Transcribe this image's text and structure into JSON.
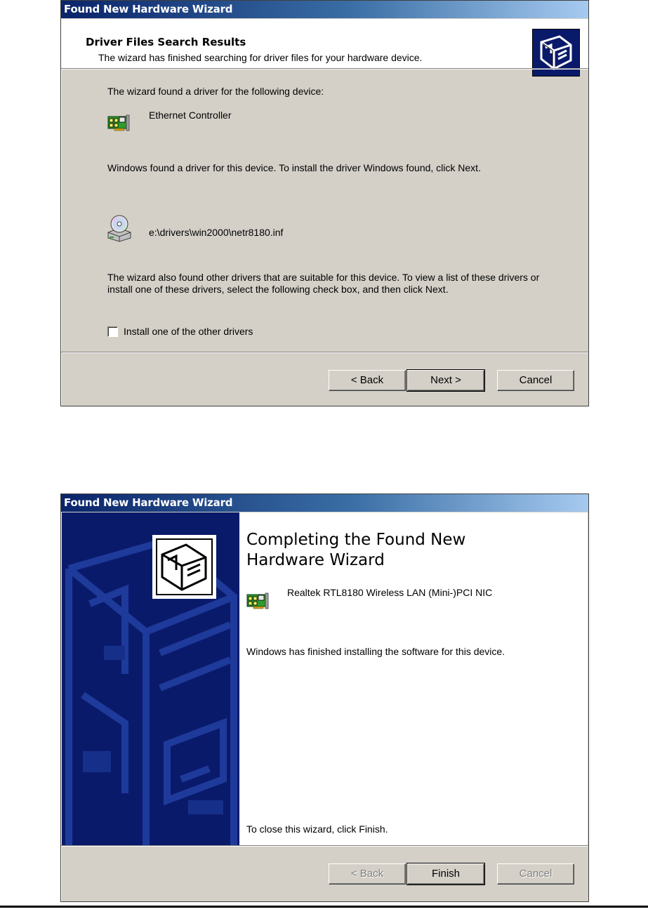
{
  "wizard1": {
    "title": "Found New Hardware Wizard",
    "header_title": "Driver Files Search Results",
    "header_subtitle": "The wizard has finished searching for driver files for your hardware device.",
    "found_text": "The wizard found a driver for the following device:",
    "device_name": "Ethernet Controller",
    "instructions": "Windows found a driver for this device. To install the driver Windows found, click Next.",
    "driver_path": "e:\\drivers\\win2000\\netr8180.inf",
    "other_drivers_text": "The wizard also found other drivers that are suitable for this device. To view a list of these drivers or install one of these drivers, select the following check box, and then click Next.",
    "checkbox_label": "Install one of the other drivers",
    "checkbox_checked": false,
    "back_label": "< Back",
    "next_label": "Next >",
    "cancel_label": "Cancel"
  },
  "wizard2": {
    "title": "Found New Hardware Wizard",
    "heading": "Completing the Found New Hardware Wizard",
    "device_name": "Realtek RTL8180 Wireless LAN (Mini-)PCI NIC",
    "finished_text": "Windows has finished installing the software for this device.",
    "close_text": "To close this wizard, click Finish.",
    "back_label": "< Back",
    "finish_label": "Finish",
    "cancel_label": "Cancel"
  },
  "icons": {
    "wizard_header_icon": "hardware-wizard-icon",
    "network_card_icon": "network-card-icon",
    "cd_drive_icon": "cd-drive-icon"
  },
  "colors": {
    "title_bar_start": "#0a246a",
    "title_bar_end": "#a6caf0",
    "dialog_face": "#d4d0c8",
    "sidebar": "#0a1a6a"
  }
}
